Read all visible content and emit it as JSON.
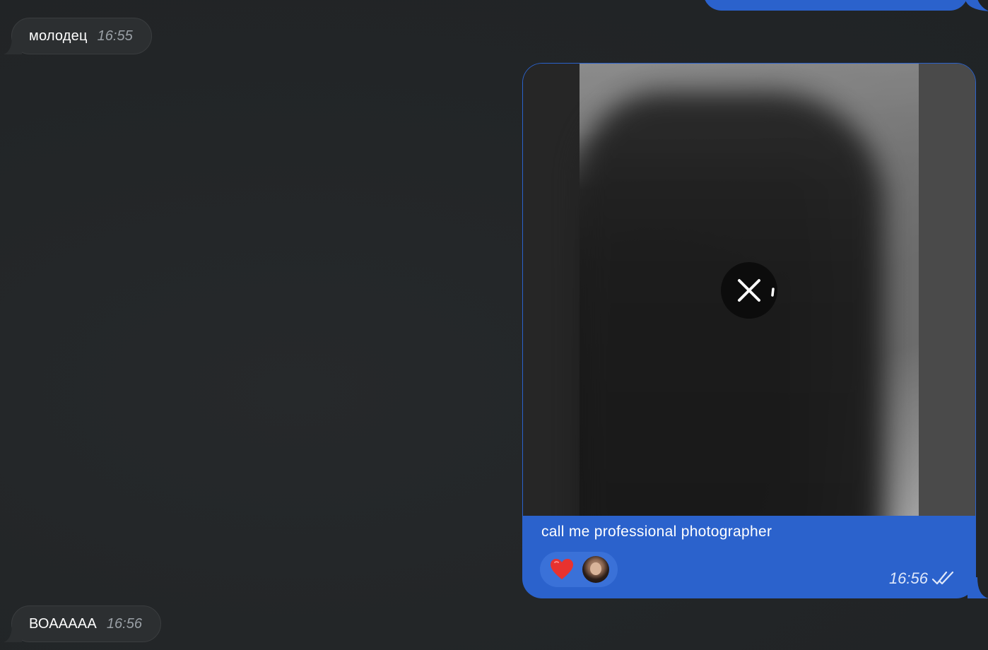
{
  "messages": {
    "incoming_1": {
      "text": "молодец",
      "time": "16:55"
    },
    "outgoing_media": {
      "caption": "call me professional photographer",
      "time": "16:56",
      "status": "read",
      "download": {
        "state": "loading",
        "action_icon": "close-icon"
      },
      "reactions": [
        {
          "emoji": "❤️",
          "icon": "heart-icon",
          "reactor": "avatar"
        }
      ]
    },
    "incoming_2": {
      "text": "ВОААААА",
      "time": "16:56"
    }
  },
  "colors": {
    "background": "#232628",
    "incoming_bubble": "#2c2f31",
    "outgoing_bubble": "#2b62cc",
    "reaction_pill": "#3a71d8",
    "heart": "#e8322f"
  }
}
